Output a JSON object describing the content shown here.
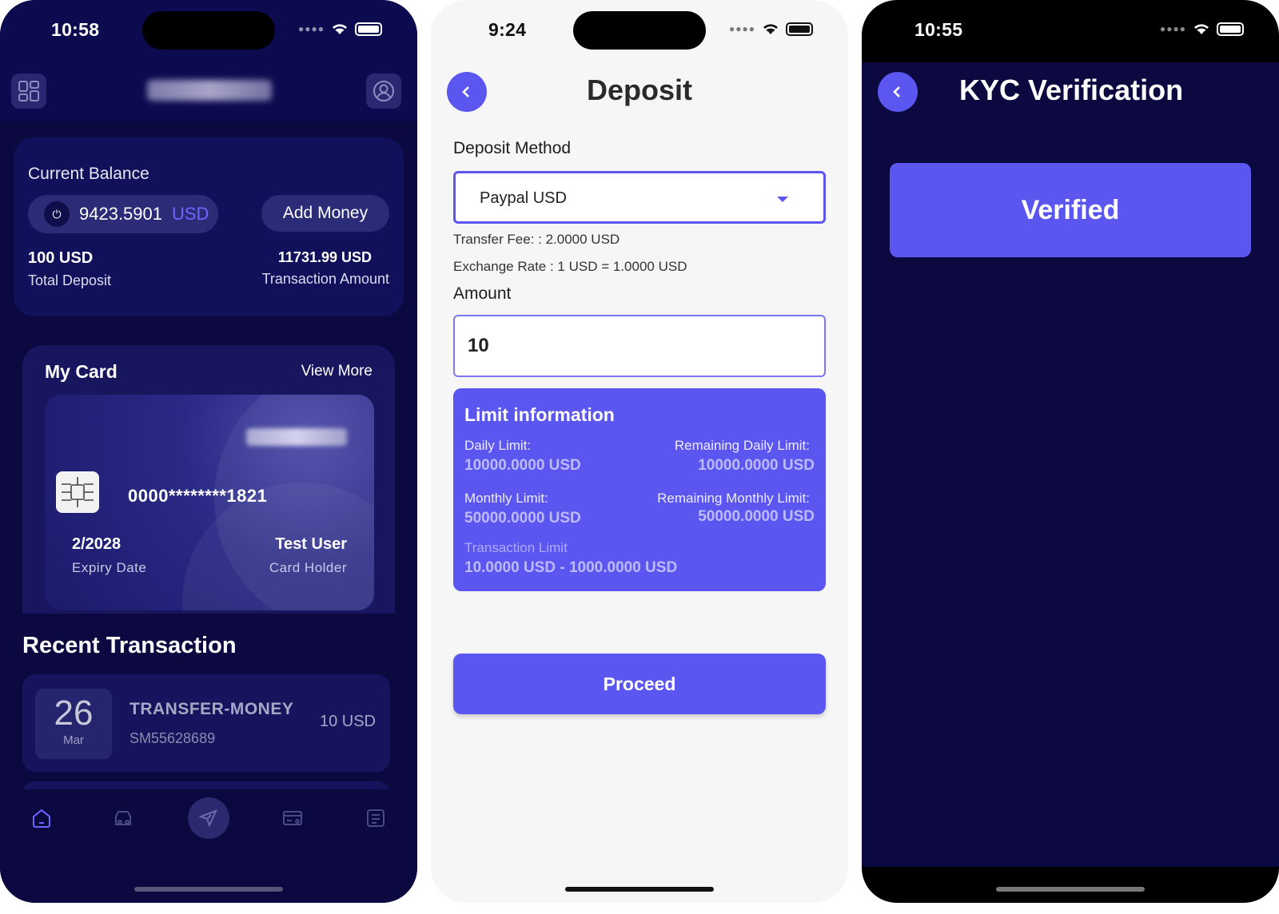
{
  "colors": {
    "accent": "#5b56f0",
    "dark_bg": "#0b0940",
    "card_bg": "#11105a"
  },
  "home": {
    "status_time": "10:58",
    "icons": {
      "menu": "grid-icon",
      "profile": "user-circle-icon"
    },
    "balance": {
      "label": "Current Balance",
      "amount": "9423.5901",
      "currency": "USD",
      "add_money": "Add Money",
      "total_deposit_value": "100 USD",
      "total_deposit_label": "Total Deposit",
      "transaction_amount_value": "11731.99 USD",
      "transaction_amount_label": "Transaction Amount"
    },
    "my_card": {
      "title": "My Card",
      "view_more": "View More",
      "number": "0000********1821",
      "expiry_value": "2/2028",
      "expiry_label": "Expiry Date",
      "holder_value": "Test User",
      "holder_label": "Card Holder"
    },
    "recent": {
      "title": "Recent Transaction",
      "items": [
        {
          "day": "26",
          "month": "Mar",
          "type": "TRANSFER-MONEY",
          "id": "SM55628689",
          "amount": "10 USD"
        }
      ]
    },
    "bottom_nav": [
      "home-icon",
      "wallet-icon",
      "send-icon",
      "card-icon",
      "document-icon"
    ]
  },
  "deposit": {
    "status_time": "9:24",
    "title": "Deposit",
    "method_label": "Deposit Method",
    "method_value": "Paypal USD",
    "transfer_fee": "Transfer Fee: : 2.0000 USD",
    "exchange_rate": "Exchange Rate : 1 USD = 1.0000 USD",
    "amount_label": "Amount",
    "amount_value": "10",
    "limits": {
      "title": "Limit information",
      "daily_label": "Daily Limit:",
      "daily_value": "10000.0000 USD",
      "remaining_daily_label": "Remaining Daily Limit:",
      "remaining_daily_value": "10000.0000 USD",
      "monthly_label": "Monthly Limit:",
      "monthly_value": "50000.0000 USD",
      "remaining_monthly_label": "Remaining Monthly Limit:",
      "remaining_monthly_value": "50000.0000 USD",
      "transaction_label": "Transaction Limit",
      "transaction_value": "10.0000 USD - 1000.0000 USD"
    },
    "proceed": "Proceed"
  },
  "kyc": {
    "status_time": "10:55",
    "title": "KYC Verification",
    "status": "Verified"
  }
}
